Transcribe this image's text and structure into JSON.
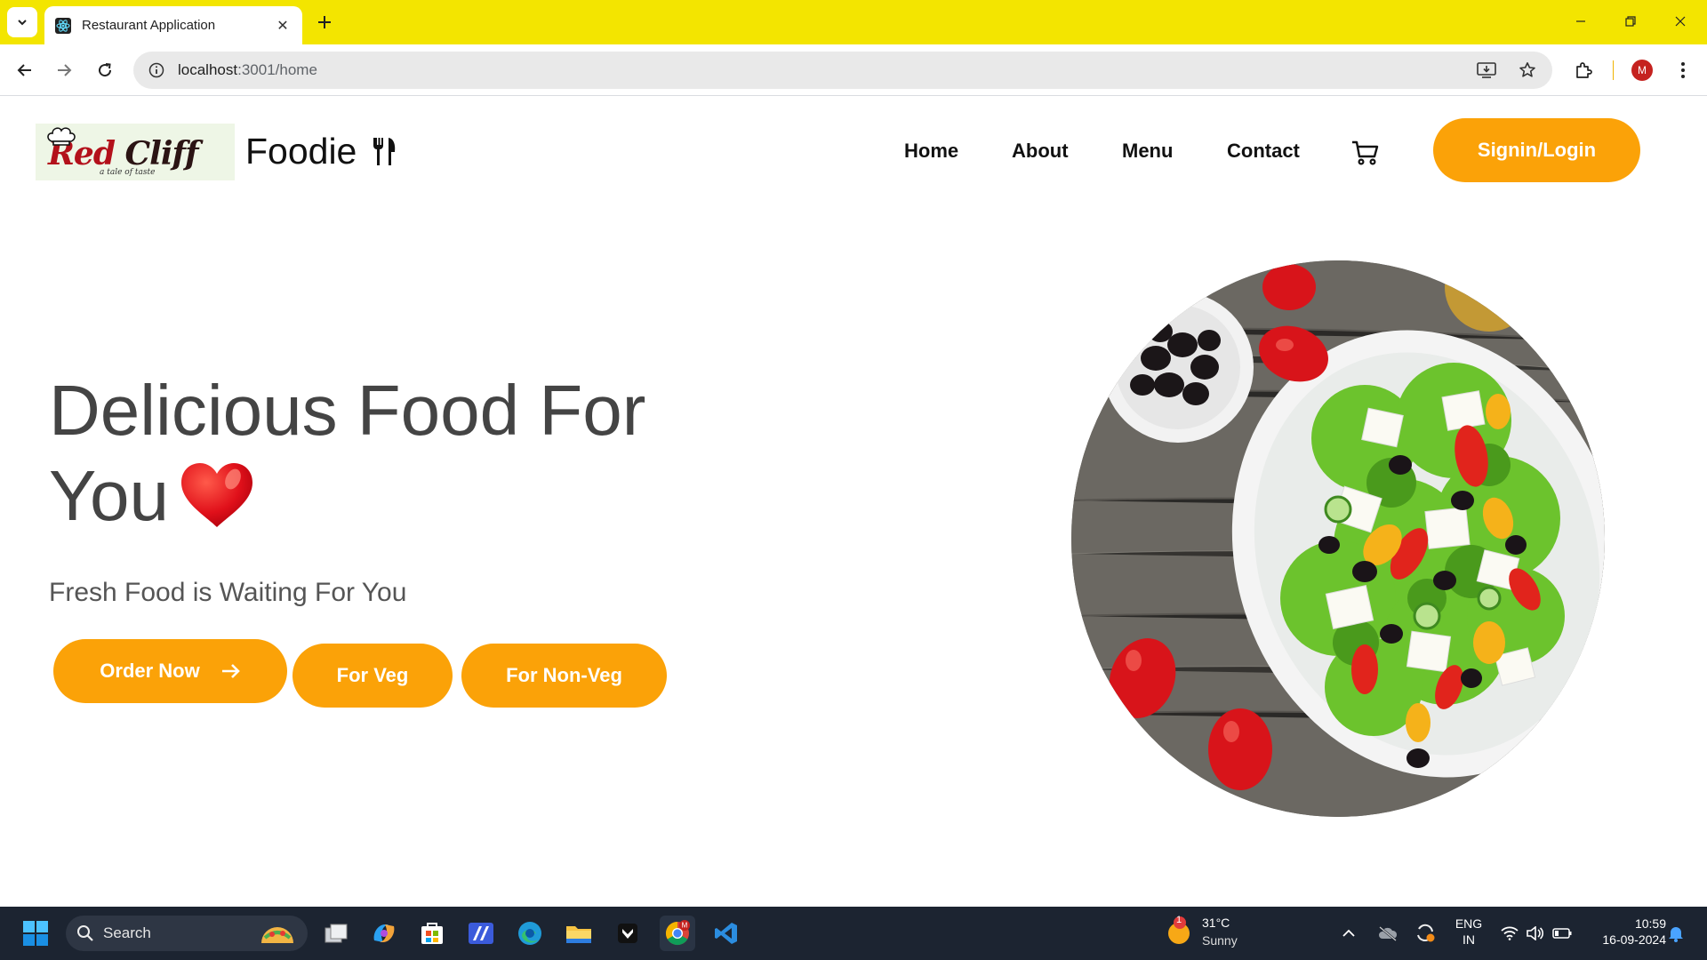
{
  "browser": {
    "tab_title": "Restaurant Application",
    "url_host": "localhost",
    "url_path": ":3001/home",
    "profile_initial": "M"
  },
  "site": {
    "logo_text_red": "Red",
    "logo_text_dark": " Cliff",
    "logo_tagline": "a tale of taste",
    "brand_name": "Foodie",
    "nav": [
      "Home",
      "About",
      "Menu",
      "Contact"
    ],
    "signin_label": "Signin/Login"
  },
  "hero": {
    "title_line1": "Delicious Food For",
    "title_line2": "You",
    "subtitle": "Fresh Food is Waiting For You",
    "order_now_label": "Order Now",
    "veg_label": "For Veg",
    "nonveg_label": "For Non-Veg",
    "accent_color": "#fba208"
  },
  "taskbar": {
    "search_placeholder": "Search",
    "weather_badge": "1",
    "weather_temp": "31°C",
    "weather_cond": "Sunny",
    "lang_line1": "ENG",
    "lang_line2": "IN",
    "time": "10:59",
    "date": "16-09-2024"
  }
}
